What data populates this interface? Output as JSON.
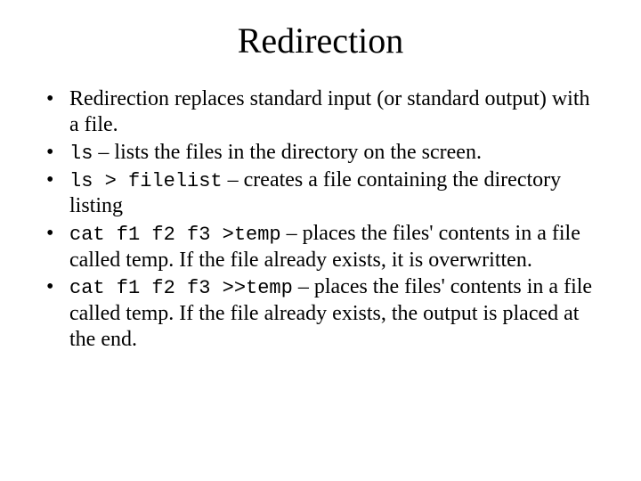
{
  "title": "Redirection",
  "bullets": [
    {
      "pre": "Redirection replaces standard input (or standard output) with a file."
    },
    {
      "code": "ls",
      "post": " – lists the files in the directory on the screen."
    },
    {
      "code": "ls > filelist",
      "post": " – creates a file containing the directory listing"
    },
    {
      "code": "cat f1 f2 f3 >temp",
      "post": " – places the files' contents in a file called temp.  If the file already exists, it is overwritten."
    },
    {
      "code": "cat f1 f2 f3 >>temp",
      "post": " – places the files' contents in a file called temp.  If the file already exists, the output is placed at the end."
    }
  ]
}
